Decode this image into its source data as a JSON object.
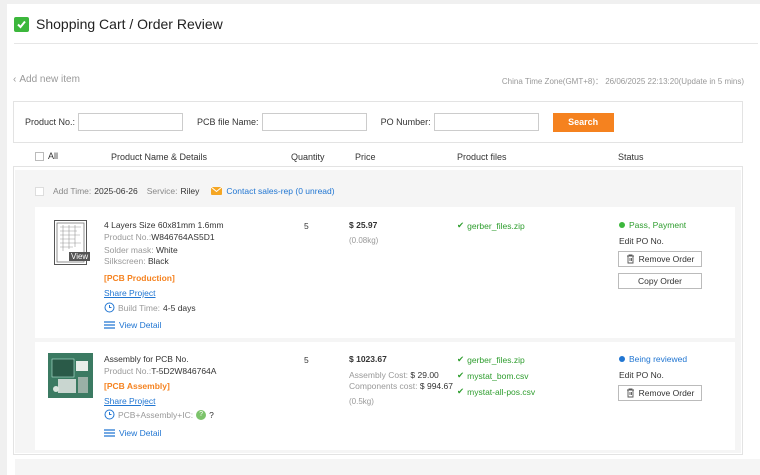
{
  "header": {
    "title": "Shopping Cart / Order Review"
  },
  "top": {
    "add_new": "Add new item",
    "timezone": "China Time Zone(GMT+8)：  26/06/2025 22:13:20(Update in 5 mins)"
  },
  "search": {
    "product_no_label": "Product No.:",
    "pcb_file_label": "PCB file Name:",
    "po_label": "PO Number:",
    "button": "Search"
  },
  "columns": {
    "all": "All",
    "name": "Product Name & Details",
    "quantity": "Quantity",
    "price": "Price",
    "files": "Product files",
    "status": "Status"
  },
  "order": {
    "add_time_label": "Add Time:",
    "add_time": "2025-06-26",
    "service_label": "Service:",
    "service": "Riley",
    "contact": "Contact sales-rep (0 unread)"
  },
  "items": [
    {
      "title": "4 Layers Size 60x81mm 1.6mm",
      "product_no_label": "Product No.:",
      "product_no": "W846764AS5D1",
      "mask_label": "Solder mask:",
      "mask": "White",
      "silk_label": "Silkscreen:",
      "silk": "Black",
      "category": "[PCB Production]",
      "share": "Share Project",
      "build_label": "Build Time:",
      "build": "4-5 days",
      "view_detail": "View Detail",
      "thumb_label": "View",
      "quantity": "5",
      "price": "$ 25.97",
      "weight": "(0.08kg)",
      "files": [
        "gerber_files.zip"
      ],
      "status": "Pass, Payment",
      "status_color": "#3cb73c",
      "edit_po": "Edit PO No.",
      "remove": "Remove Order",
      "copy": "Copy Order"
    },
    {
      "title": "Assembly for PCB No.",
      "product_no_label": "Product No.:",
      "product_no": "T-5D2W846764A",
      "category": "[PCB Assembly]",
      "share": "Share Project",
      "assembly_info": "PCB+Assembly+IC:",
      "assembly_q": "?",
      "view_detail": "View Detail",
      "quantity": "5",
      "price": "$ 1023.67",
      "assembly_cost_label": "Assembly Cost:",
      "assembly_cost": "$ 29.00",
      "components_cost_label": "Components cost:",
      "components_cost": "$ 994.67",
      "weight": "(0.5kg)",
      "files": [
        "gerber_files.zip",
        "mystat_bom.csv",
        "mystat-all-pos.csv"
      ],
      "status": "Being reviewed",
      "status_color": "#2176d2",
      "edit_po": "Edit PO No.",
      "remove": "Remove Order"
    }
  ]
}
